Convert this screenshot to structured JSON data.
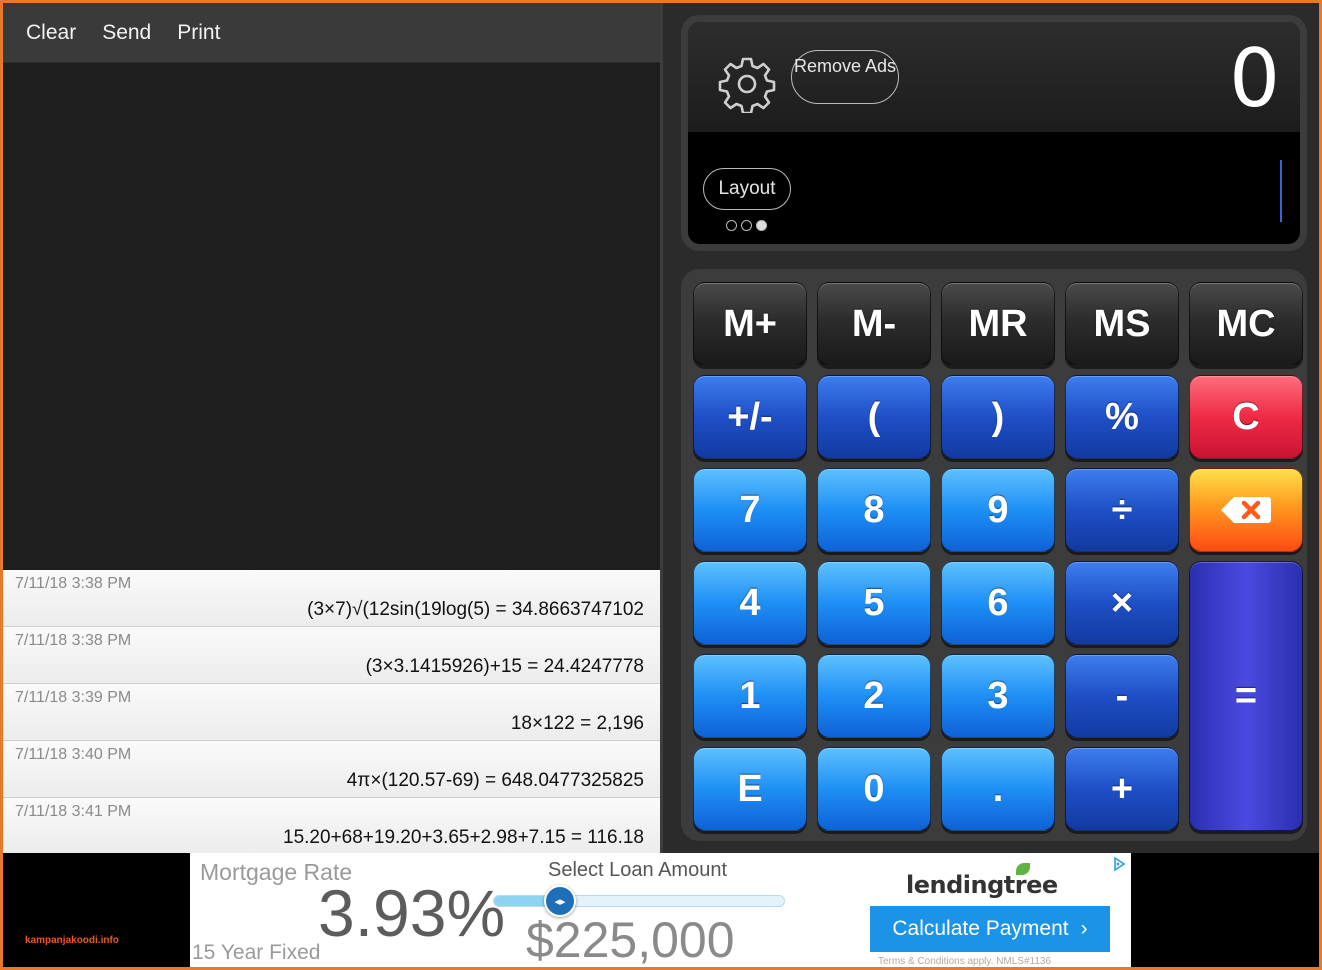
{
  "toolbar": {
    "clear": "Clear",
    "send": "Send",
    "print": "Print"
  },
  "history": [
    {
      "time": "7/11/18 3:38 PM",
      "expr": "(3×7)√(12sin(19log(5) = 34.8663747102"
    },
    {
      "time": "7/11/18 3:38 PM",
      "expr": "(3×3.1415926)+15 = 24.4247778"
    },
    {
      "time": "7/11/18 3:39 PM",
      "expr": "18×122 = 2,196"
    },
    {
      "time": "7/11/18 3:40 PM",
      "expr": "4π×(120.57-69) = 648.0477325825"
    },
    {
      "time": "7/11/18 3:41 PM",
      "expr": "15.20+68+19.20+3.65+2.98+7.15 = 116.18"
    }
  ],
  "display": {
    "remove_ads": "Remove Ads",
    "layout": "Layout",
    "value": "0",
    "page_dots": 3,
    "active_dot": 2
  },
  "keys": {
    "m_plus": "M+",
    "m_minus": "M-",
    "mr": "MR",
    "ms": "MS",
    "mc": "MC",
    "plus_minus": "+/-",
    "lparen": "(",
    "rparen": ")",
    "percent": "%",
    "clear": "C",
    "seven": "7",
    "eight": "8",
    "nine": "9",
    "divide": "÷",
    "four": "4",
    "five": "5",
    "six": "6",
    "multiply": "×",
    "one": "1",
    "two": "2",
    "three": "3",
    "minus": "-",
    "e": "E",
    "zero": "0",
    "decimal": ".",
    "plus": "+",
    "equals": "="
  },
  "ad": {
    "rate_label": "Mortgage Rate",
    "rate": "3.93%",
    "rate_term": "15 Year Fixed",
    "loan_label": "Select Loan Amount",
    "loan_amount": "$225,000",
    "slider_position": 0.25,
    "brand": "lendingtree",
    "cta": "Calculate Payment",
    "cta_arrow": "›",
    "terms": "Terms & Conditions apply. NMLS#1136"
  },
  "watermark": "kampanjakoodi.info",
  "colors": {
    "memory_key": "#2c2c2c",
    "operator_key": "#1f4fc7",
    "digit_key": "#1e8ff5",
    "clear_key": "#ef2a45",
    "backspace_key": "#ff9a1f",
    "equals_key": "#3a3ad0",
    "ad_button": "#1b93e6"
  },
  "icons": {
    "settings": "gear-icon",
    "backspace": "backspace-icon",
    "slider": "slider-knob-icon",
    "adchoices": "adchoices-icon"
  }
}
